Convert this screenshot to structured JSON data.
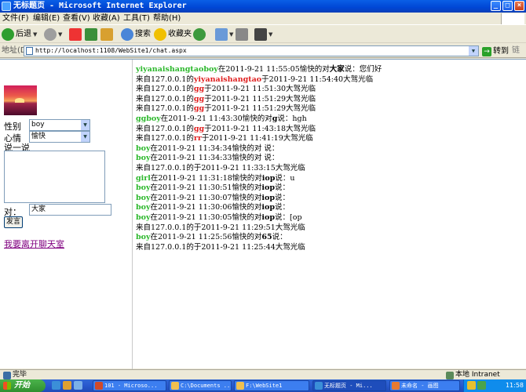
{
  "window": {
    "title": "无标题页 - Microsoft Internet Explorer",
    "buttons": {
      "minimize": "_",
      "maximize": "□",
      "close": "×"
    }
  },
  "menu": [
    "文件(F)",
    "编辑(E)",
    "查看(V)",
    "收藏(A)",
    "工具(T)",
    "帮助(H)"
  ],
  "toolbar": {
    "back": "后退",
    "search": "搜索",
    "favorites": "收藏夹"
  },
  "address": {
    "label": "地址(D)",
    "url": "http://localhost:1108/WebSite1/chat.aspx",
    "go": "转到",
    "links": "链接"
  },
  "sidebar": {
    "gender_label": "性别",
    "gender_value": "boy",
    "mood_label": "心情",
    "mood_value": "愉快",
    "say_label": "说一说",
    "to_label": "对：",
    "to_value": "大家",
    "send": "发言",
    "leave": "我要离开聊天室"
  },
  "messages": [
    {
      "parts": [
        [
          "u-green",
          "yiyanaishangtaoboy"
        ],
        [
          "",
          "在2011-9-21 11:55:05愉快的对"
        ],
        [
          "b",
          "大家"
        ],
        [
          "",
          "说：您们好"
        ]
      ]
    },
    {
      "parts": [
        [
          "",
          "来自127.0.0.1的"
        ],
        [
          "u-red",
          "yiyanaishangtao"
        ],
        [
          "",
          "于2011-9-21 11:54:40大驾光临"
        ]
      ]
    },
    {
      "parts": [
        [
          "",
          "来自127.0.0.1的"
        ],
        [
          "u-red",
          "gg"
        ],
        [
          "",
          "于2011-9-21 11:51:30大驾光临"
        ]
      ]
    },
    {
      "parts": [
        [
          "",
          "来自127.0.0.1的"
        ],
        [
          "u-red",
          "gg"
        ],
        [
          "",
          "于2011-9-21 11:51:29大驾光临"
        ]
      ]
    },
    {
      "parts": [
        [
          "",
          "来自127.0.0.1的"
        ],
        [
          "u-red",
          "gg"
        ],
        [
          "",
          "于2011-9-21 11:51:29大驾光临"
        ]
      ]
    },
    {
      "parts": [
        [
          "u-green",
          "ggboy"
        ],
        [
          "",
          "在2011-9-21 11:43:30愉快的对"
        ],
        [
          "b",
          "g"
        ],
        [
          "",
          "说：hgh"
        ]
      ]
    },
    {
      "parts": [
        [
          "",
          "来自127.0.0.1的"
        ],
        [
          "u-red",
          "gg"
        ],
        [
          "",
          "于2011-9-21 11:43:18大驾光临"
        ]
      ]
    },
    {
      "parts": [
        [
          "",
          "来自127.0.0.1的"
        ],
        [
          "u-red",
          "rr"
        ],
        [
          "",
          "于2011-9-21 11:41:19大驾光临"
        ]
      ]
    },
    {
      "parts": [
        [
          "u-green",
          "boy"
        ],
        [
          "",
          "在2011-9-21 11:34:34愉快的对 说："
        ]
      ]
    },
    {
      "parts": [
        [
          "u-green",
          "boy"
        ],
        [
          "",
          "在2011-9-21 11:34:33愉快的对 说："
        ]
      ]
    },
    {
      "parts": [
        [
          "",
          "来自127.0.0.1的于2011-9-21 11:33:15大驾光临"
        ]
      ]
    },
    {
      "parts": [
        [
          "u-green",
          "girl"
        ],
        [
          "",
          "在2011-9-21 11:31:18愉快的对"
        ],
        [
          "b",
          "iop"
        ],
        [
          "",
          "说：u"
        ]
      ]
    },
    {
      "parts": [
        [
          "u-green",
          "boy"
        ],
        [
          "",
          "在2011-9-21 11:30:51愉快的对"
        ],
        [
          "b",
          "iop"
        ],
        [
          "",
          "说："
        ]
      ]
    },
    {
      "parts": [
        [
          "u-green",
          "boy"
        ],
        [
          "",
          "在2011-9-21 11:30:07愉快的对"
        ],
        [
          "b",
          "iop"
        ],
        [
          "",
          "说："
        ]
      ]
    },
    {
      "parts": [
        [
          "u-green",
          "boy"
        ],
        [
          "",
          "在2011-9-21 11:30:06愉快的对"
        ],
        [
          "b",
          "iop"
        ],
        [
          "",
          "说："
        ]
      ]
    },
    {
      "parts": [
        [
          "u-green",
          "boy"
        ],
        [
          "",
          "在2011-9-21 11:30:05愉快的对"
        ],
        [
          "b",
          "iop"
        ],
        [
          "",
          "说：[op"
        ]
      ]
    },
    {
      "parts": [
        [
          "",
          "来自127.0.0.1的于2011-9-21 11:29:51大驾光临"
        ]
      ]
    },
    {
      "parts": [
        [
          "u-green",
          "boy"
        ],
        [
          "",
          "在2011-9-21 11:25:56愉快的对"
        ],
        [
          "b",
          "65"
        ],
        [
          "",
          "说："
        ]
      ]
    },
    {
      "parts": [
        [
          "",
          "来自127.0.0.1的于2011-9-21 11:25:44大驾光临"
        ]
      ]
    }
  ],
  "status": {
    "left": "完毕",
    "zone": "本地 Intranet"
  },
  "taskbar": {
    "start": "开始",
    "tasks": [
      "101 - Microso...",
      "C:\\Documents ...",
      "F:\\WebSite1",
      "无标题页 - Mi...",
      "未命名 - 画图"
    ],
    "clock": "11:58"
  }
}
